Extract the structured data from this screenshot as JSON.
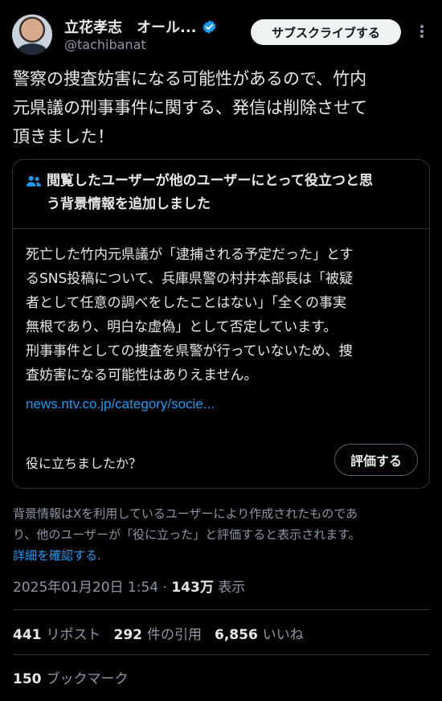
{
  "author": {
    "display_name": "立花孝志　オール...",
    "handle": "@tachibanat",
    "verified_icon": "verified-badge-icon"
  },
  "header": {
    "subscribe_label": "サブスクライブする",
    "more_icon": "more-options-icon"
  },
  "tweet": {
    "text_lines": [
      "警察の捜査妨害になる可能性があるので、竹内",
      "元県議の刑事事件に関する、発信は削除させて",
      "頂きました！"
    ]
  },
  "community_note": {
    "icon": "people-icon",
    "title_lines": [
      "閲覧したユーザーが他のユーザーにとって役立つと思",
      "う背景情報を追加しました"
    ],
    "body_lines": [
      "死亡した竹内元県議が「逮捕される予定だった」とす",
      "るSNS投稿について、兵庫県警の村井本部長は「被疑",
      "者として任意の調べをしたことはない」「全くの事実",
      "無根であり、明白な虚偽」として否定しています。",
      "刑事事件としての捜査を県警が行っていないため、捜",
      "査妨害になる可能性はありえません。"
    ],
    "link": "news.ntv.co.jp/category/socie...",
    "helpful_question": "役に立ちましたか？",
    "rate_label": "評価する"
  },
  "disclaimer": {
    "line1": "背景情報はXを利用しているユーザーにより作成されたものであ",
    "line2": "り、他のユーザーが「役に立った」と評価すると表示されます。",
    "learn_more": "詳細を確認する",
    "learn_more_suffix": "."
  },
  "meta": {
    "timestamp": "2025年01月20日 1:54",
    "separator": "·",
    "views": "143万",
    "views_label": "表示"
  },
  "stats": {
    "reposts_count": "441",
    "reposts_label": "リポスト",
    "quotes_count": "292",
    "quotes_label": "件の引用",
    "likes_count": "6,856",
    "likes_label": "いいね",
    "bookmarks_count": "150",
    "bookmarks_label": "ブックマーク"
  },
  "colors": {
    "background": "#000000",
    "text": "#e7e9ea",
    "secondary": "#8b98a5",
    "accent": "#1d9bf0",
    "border": "#2f3336"
  }
}
